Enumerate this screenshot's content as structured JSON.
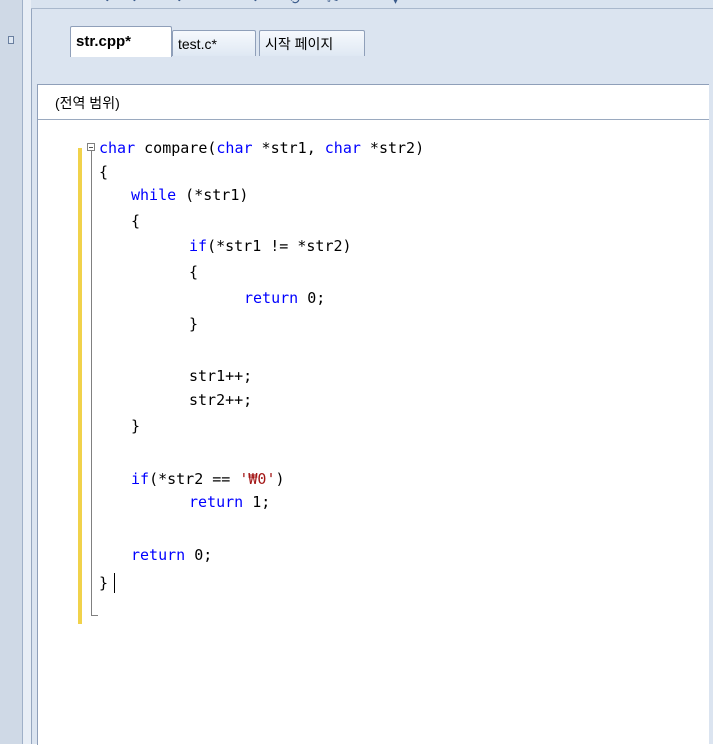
{
  "tabs": [
    {
      "label": "str.cpp*",
      "active": true
    },
    {
      "label": "test.c*",
      "active": false
    },
    {
      "label": "시작 페이지",
      "active": false
    }
  ],
  "scope": {
    "label": "(전역 범위)"
  },
  "code": {
    "lines": [
      {
        "indent": 0,
        "segments": [
          {
            "text": "char",
            "kw": true
          },
          {
            "text": " compare("
          },
          {
            "text": "char",
            "kw": true
          },
          {
            "text": " *str1, "
          },
          {
            "text": "char",
            "kw": true
          },
          {
            "text": " *str2)"
          }
        ]
      },
      {
        "indent": 0,
        "segments": [
          {
            "text": "{"
          }
        ]
      },
      {
        "indent": 1,
        "segments": [
          {
            "text": "while",
            "kw": true
          },
          {
            "text": " (*str1)"
          }
        ]
      },
      {
        "indent": 1,
        "segments": [
          {
            "text": "{"
          }
        ]
      },
      {
        "indent": 2,
        "segments": [
          {
            "text": "if",
            "kw": true
          },
          {
            "text": "(*str1 != *str2)"
          }
        ]
      },
      {
        "indent": 2,
        "segments": [
          {
            "text": "{"
          }
        ]
      },
      {
        "indent": 3,
        "segments": [
          {
            "text": "return",
            "kw": true
          },
          {
            "text": " 0;"
          }
        ]
      },
      {
        "indent": 2,
        "segments": [
          {
            "text": "}"
          }
        ]
      },
      {
        "indent": 0,
        "segments": []
      },
      {
        "indent": 2,
        "segments": [
          {
            "text": "str1++;"
          }
        ]
      },
      {
        "indent": 2,
        "segments": [
          {
            "text": "str2++;"
          }
        ]
      },
      {
        "indent": 1,
        "segments": [
          {
            "text": "}"
          }
        ]
      },
      {
        "indent": 0,
        "segments": []
      },
      {
        "indent": 1,
        "segments": [
          {
            "text": "if",
            "kw": true
          },
          {
            "text": "(*str2 == "
          },
          {
            "text": "'₩0'",
            "str": true
          },
          {
            "text": ")"
          }
        ]
      },
      {
        "indent": 2,
        "segments": [
          {
            "text": "return",
            "kw": true
          },
          {
            "text": " 1;"
          }
        ]
      },
      {
        "indent": 0,
        "segments": []
      },
      {
        "indent": 1,
        "segments": [
          {
            "text": "return",
            "kw": true
          },
          {
            "text": " 0;"
          }
        ]
      },
      {
        "indent": 0,
        "segments": [
          {
            "text": "}"
          }
        ]
      }
    ]
  },
  "colors": {
    "keyword": "#0000ff",
    "string": "#a31515",
    "change_marker": "#f1d24b"
  },
  "icons": [
    "collapse-minus-icon",
    "pin-icon"
  ]
}
